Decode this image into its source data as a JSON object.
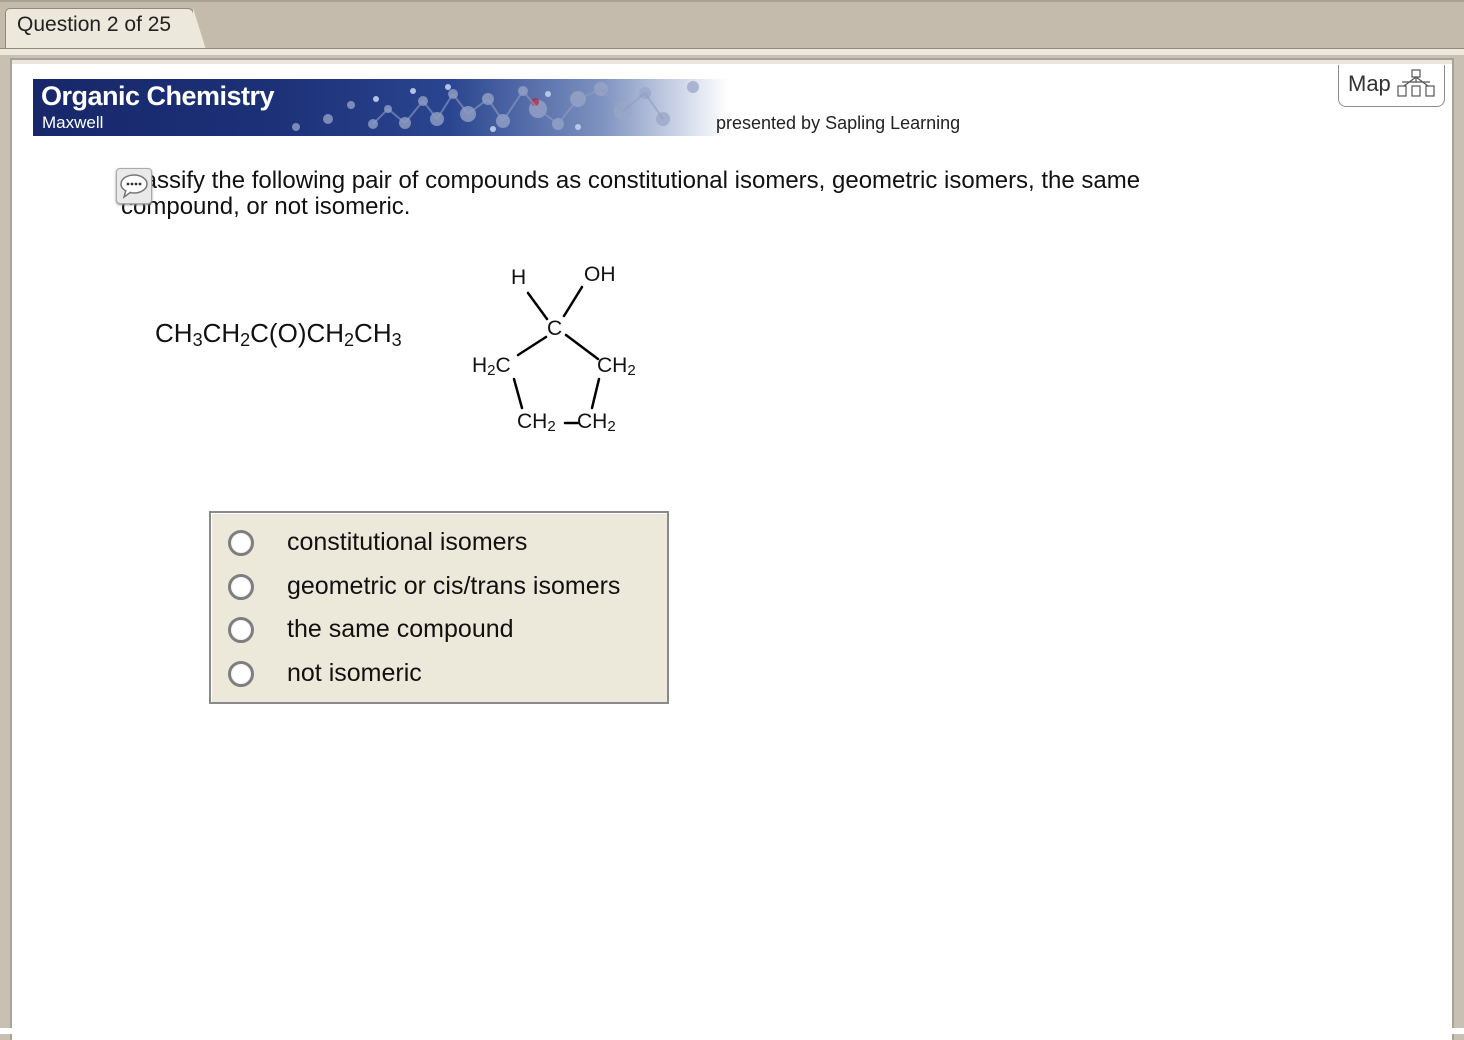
{
  "tab": {
    "label": "Question 2 of 25"
  },
  "banner": {
    "title": "Organic Chemistry",
    "subtitle": "Maxwell"
  },
  "presented_by": "presented by Sapling Learning",
  "map_button": {
    "label": "Map",
    "icon": "sitemap-icon"
  },
  "hint_icon": "speech-bubble-icon",
  "question": {
    "text": "Classify the following pair of compounds as constitutional isomers, geometric isomers, the same compound, or not isomeric."
  },
  "compound1": {
    "parts": [
      "CH",
      "3",
      "CH",
      "2",
      "C(O)CH",
      "2",
      "CH",
      "3"
    ]
  },
  "compound2": {
    "labels": {
      "h": "H",
      "oh": "OH",
      "c": "C",
      "left_h": "H",
      "left_sub": "2",
      "left_c": "C",
      "right_ch": "CH",
      "right_sub": "2",
      "bottom_left_ch": "CH",
      "bottom_left_sub": "2",
      "bottom_right_ch": "CH",
      "bottom_right_sub": "2"
    }
  },
  "choices": [
    {
      "label": "constitutional isomers",
      "selected": false
    },
    {
      "label": "geometric or cis/trans isomers",
      "selected": false
    },
    {
      "label": "the same compound",
      "selected": false
    },
    {
      "label": "not isomeric",
      "selected": false
    }
  ]
}
